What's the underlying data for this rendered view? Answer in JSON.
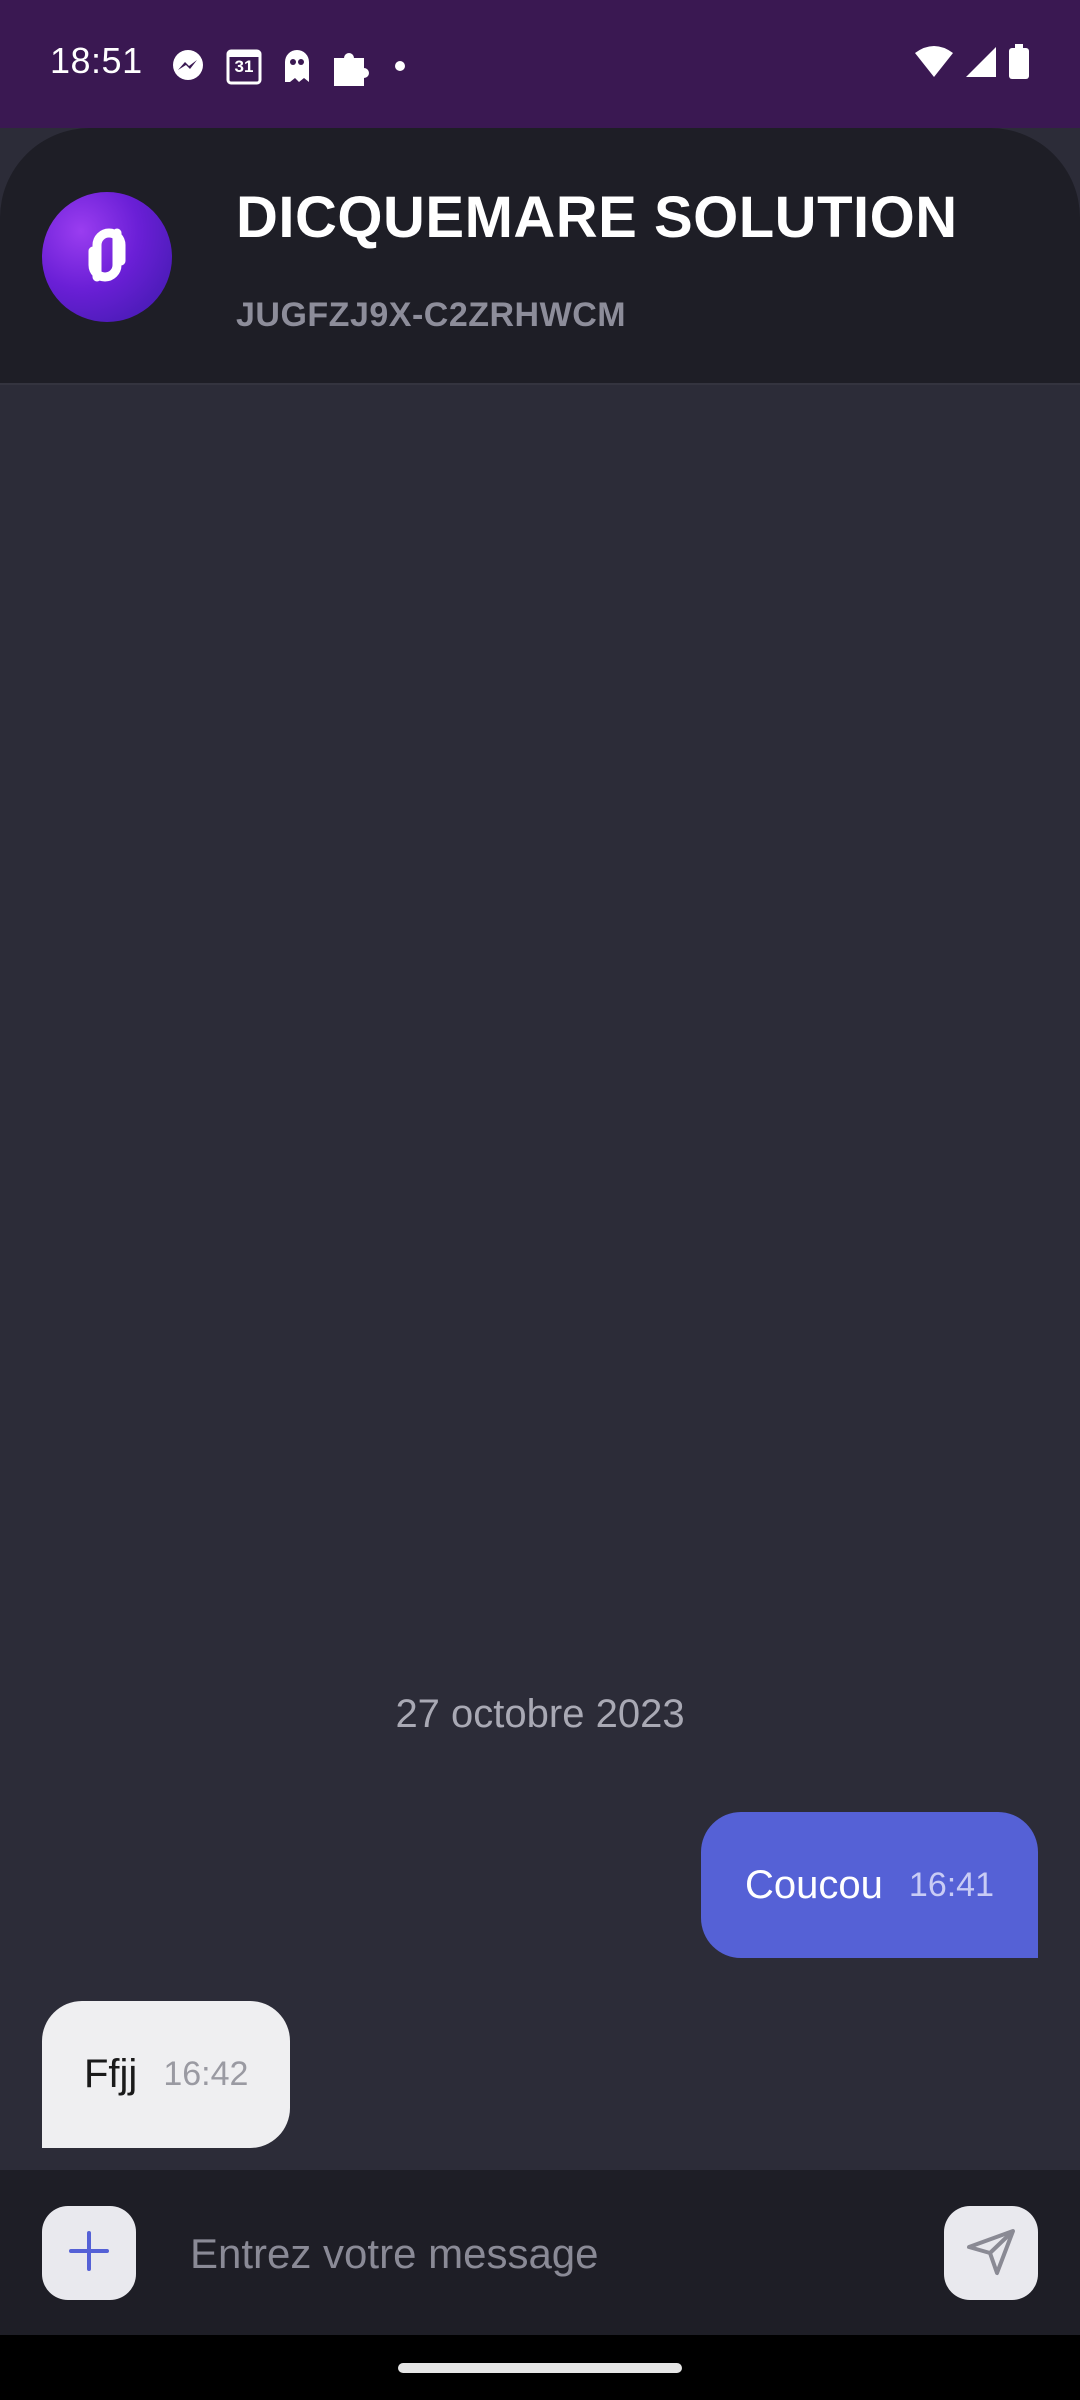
{
  "status_bar": {
    "time": "18:51",
    "calendar_day": "31",
    "left_icons": [
      "messenger-icon",
      "calendar-icon",
      "ghost-icon",
      "puzzle-icon",
      "dot-icon"
    ],
    "right_icons": [
      "wifi-icon",
      "signal-icon",
      "battery-icon"
    ]
  },
  "header": {
    "title": "DICQUEMARE SOLUTION",
    "subtitle": "JUGFZJ9X-C2ZRHWCM",
    "avatar_icon": "link-logo-icon"
  },
  "conversation": {
    "date_label": "27 octobre 2023",
    "messages": [
      {
        "direction": "outgoing",
        "text": "Coucou",
        "time": "16:41"
      },
      {
        "direction": "incoming",
        "text": "Ffjj",
        "time": "16:42"
      }
    ]
  },
  "composer": {
    "placeholder": "Entrez votre message",
    "add_icon": "plus-icon",
    "send_icon": "send-icon"
  },
  "colors": {
    "status_bar_bg": "#3a1852",
    "header_bg": "#1e1e26",
    "chat_bg": "#2c2c38",
    "outgoing_bubble": "#5561d6",
    "incoming_bubble": "#efeff1",
    "accent": "#5561d6"
  }
}
